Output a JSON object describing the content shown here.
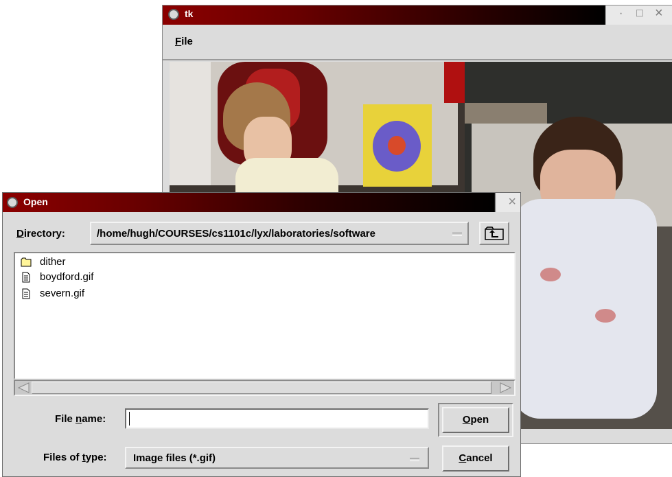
{
  "background_window": {
    "title": "tk",
    "controls": {
      "minimize": "·",
      "maximize": "□",
      "close": "×"
    },
    "menu": {
      "file_mnemonic": "F",
      "file_rest": "ile"
    },
    "image_icon": "photo-of-two-children"
  },
  "dialog": {
    "title": "Open",
    "close_glyph": "×",
    "directory": {
      "label_mnemonic": "D",
      "label_rest": "irectory:",
      "value": "/home/hugh/COURSES/cs1101c/lyx/laboratories/software"
    },
    "files": [
      {
        "name": "dither",
        "icon": "folder-icon"
      },
      {
        "name": "boydford.gif",
        "icon": "file-icon"
      },
      {
        "name": "severn.gif",
        "icon": "file-icon"
      }
    ],
    "filename": {
      "label_pre": "File ",
      "label_mnemonic": "n",
      "label_rest": "ame:",
      "value": ""
    },
    "filetype": {
      "label_pre": "Files of ",
      "label_mnemonic": "t",
      "label_rest": "ype:",
      "value": "Image files (*.gif)"
    },
    "buttons": {
      "open_mnemonic": "O",
      "open_rest": "pen",
      "cancel_mnemonic": "C",
      "cancel_rest": "ancel"
    }
  },
  "colors": {
    "titlebar_start": "#8b0000",
    "titlebar_end": "#000000",
    "window_bg": "#dcdcdc",
    "list_bg": "#ffffff",
    "folder_fill": "#fff59a"
  }
}
